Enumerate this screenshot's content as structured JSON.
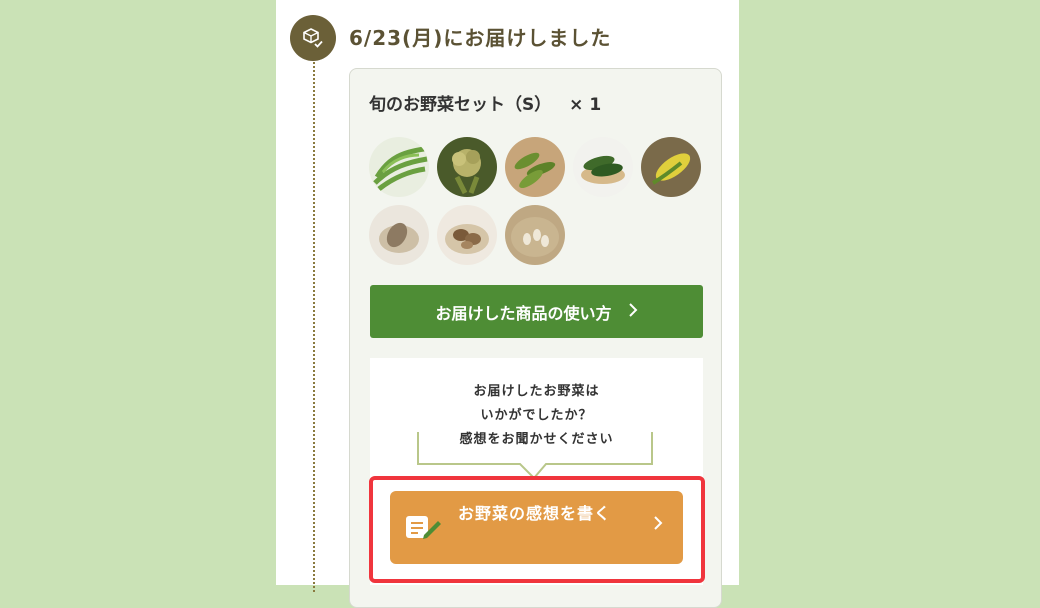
{
  "delivery": {
    "status_title": "6/23(月)にお届けしました",
    "status_icon": "package-check-icon"
  },
  "product": {
    "name": "旬のお野菜セット（S）",
    "quantity": "× 1"
  },
  "vegetables": [
    {
      "name": "greens",
      "color": "#6aa040"
    },
    {
      "name": "broccoli",
      "color": "#7a8a3a"
    },
    {
      "name": "edamame",
      "color": "#6b8f30"
    },
    {
      "name": "zucchini",
      "color": "#3f6a2a"
    },
    {
      "name": "corn",
      "color": "#d8c33a"
    },
    {
      "name": "taro",
      "color": "#9a8670"
    },
    {
      "name": "mushroom",
      "color": "#a8906e"
    },
    {
      "name": "beans",
      "color": "#b9a98e"
    }
  ],
  "usage_button": {
    "label": "お届けした商品の使い方",
    "chevron": "›"
  },
  "review_prompt": {
    "line1": "お届けしたお野菜は",
    "line2": "いかがでしたか？",
    "line3": "感想をお聞かせください"
  },
  "review_button": {
    "label": "お野菜の感想を書く",
    "chevron": "›",
    "icon": "note-pencil-icon"
  },
  "colors": {
    "background": "#cae2b6",
    "accent_green": "#4e8d35",
    "accent_orange": "#e29a45",
    "highlight_red": "#f0353d",
    "status_brown": "#6b6038"
  }
}
